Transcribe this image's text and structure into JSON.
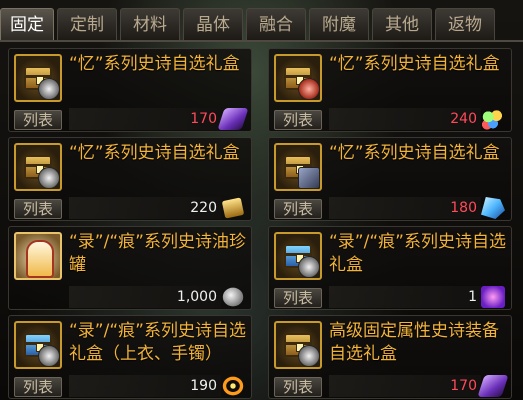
{
  "tabs": [
    "固定",
    "定制",
    "材料",
    "晶体",
    "融合",
    "附魔",
    "其他",
    "返物"
  ],
  "active_tab": "固定",
  "list_label": "列表",
  "items": [
    {
      "title": "“忆”系列史诗自选礼盒",
      "price": "170",
      "price_color": "red",
      "icon": "gold-chest-icon",
      "currency_icon": "purple-crystal-icon"
    },
    {
      "title": "“忆”系列史诗自选礼盒",
      "price": "240",
      "price_color": "red",
      "icon": "gold-chest-icon",
      "currency_icon": "rainbow-gems-icon"
    },
    {
      "title": "“忆”系列史诗自选礼盒",
      "price": "220",
      "price_color": "white",
      "icon": "gold-chest-icon",
      "currency_icon": "gold-ore-icon"
    },
    {
      "title": "“忆”系列史诗自选礼盒",
      "price": "180",
      "price_color": "red",
      "icon": "gold-chest-icon",
      "currency_icon": "blue-crystal-icon"
    },
    {
      "title": "“录”/“痕”系列史诗油珍罐",
      "price": "1,000",
      "price_color": "white",
      "icon": "costume-figure-icon",
      "currency_icon": "silver-stone-icon"
    },
    {
      "title": "“录”/“痕”系列史诗自选礼盒",
      "price": "1",
      "price_color": "white",
      "icon": "blue-chest-icon",
      "currency_icon": "violet-ticket-icon"
    },
    {
      "title": "“录”/“痕”系列史诗自选礼盒（上衣、手镯）",
      "price": "190",
      "price_color": "white",
      "icon": "blue-chest-icon",
      "currency_icon": "fire-ring-icon"
    },
    {
      "title": "高级固定属性史诗装备自选礼盒",
      "price": "170",
      "price_color": "red",
      "icon": "gold-chest-icon",
      "currency_icon": "purple-crystal-icon"
    }
  ]
}
